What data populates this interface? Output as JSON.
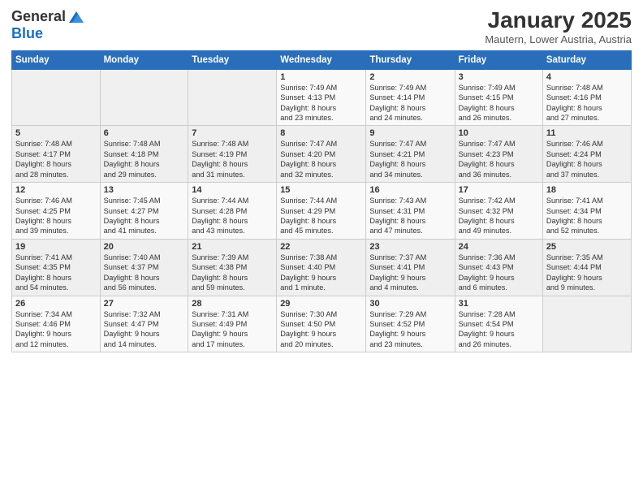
{
  "header": {
    "logo_general": "General",
    "logo_blue": "Blue",
    "month_title": "January 2025",
    "location": "Mautern, Lower Austria, Austria"
  },
  "days_of_week": [
    "Sunday",
    "Monday",
    "Tuesday",
    "Wednesday",
    "Thursday",
    "Friday",
    "Saturday"
  ],
  "weeks": [
    [
      {
        "day": "",
        "content": ""
      },
      {
        "day": "",
        "content": ""
      },
      {
        "day": "",
        "content": ""
      },
      {
        "day": "1",
        "content": "Sunrise: 7:49 AM\nSunset: 4:13 PM\nDaylight: 8 hours\nand 23 minutes."
      },
      {
        "day": "2",
        "content": "Sunrise: 7:49 AM\nSunset: 4:14 PM\nDaylight: 8 hours\nand 24 minutes."
      },
      {
        "day": "3",
        "content": "Sunrise: 7:49 AM\nSunset: 4:15 PM\nDaylight: 8 hours\nand 26 minutes."
      },
      {
        "day": "4",
        "content": "Sunrise: 7:48 AM\nSunset: 4:16 PM\nDaylight: 8 hours\nand 27 minutes."
      }
    ],
    [
      {
        "day": "5",
        "content": "Sunrise: 7:48 AM\nSunset: 4:17 PM\nDaylight: 8 hours\nand 28 minutes."
      },
      {
        "day": "6",
        "content": "Sunrise: 7:48 AM\nSunset: 4:18 PM\nDaylight: 8 hours\nand 29 minutes."
      },
      {
        "day": "7",
        "content": "Sunrise: 7:48 AM\nSunset: 4:19 PM\nDaylight: 8 hours\nand 31 minutes."
      },
      {
        "day": "8",
        "content": "Sunrise: 7:47 AM\nSunset: 4:20 PM\nDaylight: 8 hours\nand 32 minutes."
      },
      {
        "day": "9",
        "content": "Sunrise: 7:47 AM\nSunset: 4:21 PM\nDaylight: 8 hours\nand 34 minutes."
      },
      {
        "day": "10",
        "content": "Sunrise: 7:47 AM\nSunset: 4:23 PM\nDaylight: 8 hours\nand 36 minutes."
      },
      {
        "day": "11",
        "content": "Sunrise: 7:46 AM\nSunset: 4:24 PM\nDaylight: 8 hours\nand 37 minutes."
      }
    ],
    [
      {
        "day": "12",
        "content": "Sunrise: 7:46 AM\nSunset: 4:25 PM\nDaylight: 8 hours\nand 39 minutes."
      },
      {
        "day": "13",
        "content": "Sunrise: 7:45 AM\nSunset: 4:27 PM\nDaylight: 8 hours\nand 41 minutes."
      },
      {
        "day": "14",
        "content": "Sunrise: 7:44 AM\nSunset: 4:28 PM\nDaylight: 8 hours\nand 43 minutes."
      },
      {
        "day": "15",
        "content": "Sunrise: 7:44 AM\nSunset: 4:29 PM\nDaylight: 8 hours\nand 45 minutes."
      },
      {
        "day": "16",
        "content": "Sunrise: 7:43 AM\nSunset: 4:31 PM\nDaylight: 8 hours\nand 47 minutes."
      },
      {
        "day": "17",
        "content": "Sunrise: 7:42 AM\nSunset: 4:32 PM\nDaylight: 8 hours\nand 49 minutes."
      },
      {
        "day": "18",
        "content": "Sunrise: 7:41 AM\nSunset: 4:34 PM\nDaylight: 8 hours\nand 52 minutes."
      }
    ],
    [
      {
        "day": "19",
        "content": "Sunrise: 7:41 AM\nSunset: 4:35 PM\nDaylight: 8 hours\nand 54 minutes."
      },
      {
        "day": "20",
        "content": "Sunrise: 7:40 AM\nSunset: 4:37 PM\nDaylight: 8 hours\nand 56 minutes."
      },
      {
        "day": "21",
        "content": "Sunrise: 7:39 AM\nSunset: 4:38 PM\nDaylight: 8 hours\nand 59 minutes."
      },
      {
        "day": "22",
        "content": "Sunrise: 7:38 AM\nSunset: 4:40 PM\nDaylight: 9 hours\nand 1 minute."
      },
      {
        "day": "23",
        "content": "Sunrise: 7:37 AM\nSunset: 4:41 PM\nDaylight: 9 hours\nand 4 minutes."
      },
      {
        "day": "24",
        "content": "Sunrise: 7:36 AM\nSunset: 4:43 PM\nDaylight: 9 hours\nand 6 minutes."
      },
      {
        "day": "25",
        "content": "Sunrise: 7:35 AM\nSunset: 4:44 PM\nDaylight: 9 hours\nand 9 minutes."
      }
    ],
    [
      {
        "day": "26",
        "content": "Sunrise: 7:34 AM\nSunset: 4:46 PM\nDaylight: 9 hours\nand 12 minutes."
      },
      {
        "day": "27",
        "content": "Sunrise: 7:32 AM\nSunset: 4:47 PM\nDaylight: 9 hours\nand 14 minutes."
      },
      {
        "day": "28",
        "content": "Sunrise: 7:31 AM\nSunset: 4:49 PM\nDaylight: 9 hours\nand 17 minutes."
      },
      {
        "day": "29",
        "content": "Sunrise: 7:30 AM\nSunset: 4:50 PM\nDaylight: 9 hours\nand 20 minutes."
      },
      {
        "day": "30",
        "content": "Sunrise: 7:29 AM\nSunset: 4:52 PM\nDaylight: 9 hours\nand 23 minutes."
      },
      {
        "day": "31",
        "content": "Sunrise: 7:28 AM\nSunset: 4:54 PM\nDaylight: 9 hours\nand 26 minutes."
      },
      {
        "day": "",
        "content": ""
      }
    ]
  ]
}
